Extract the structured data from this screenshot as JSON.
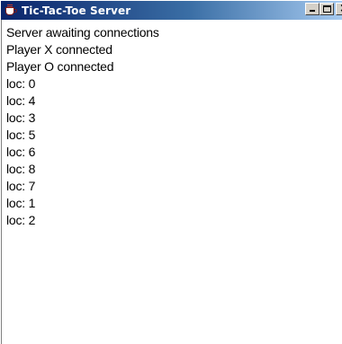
{
  "window": {
    "title": "Tic-Tac-Toe Server",
    "icon": "java-cup-icon",
    "buttons": {
      "minimize": "minimize-icon",
      "maximize": "maximize-icon",
      "close": "close-icon"
    }
  },
  "log": {
    "lines": [
      "Server awaiting connections",
      "Player X connected",
      "Player O connected",
      "loc: 0",
      "loc: 4",
      "loc: 3",
      "loc: 5",
      "loc: 6",
      "loc: 8",
      "loc: 7",
      "loc: 1",
      "loc: 2"
    ]
  },
  "colors": {
    "titlebar_start": "#0a246a",
    "titlebar_end": "#a6caf0",
    "background": "#ffffff",
    "text": "#000000"
  }
}
